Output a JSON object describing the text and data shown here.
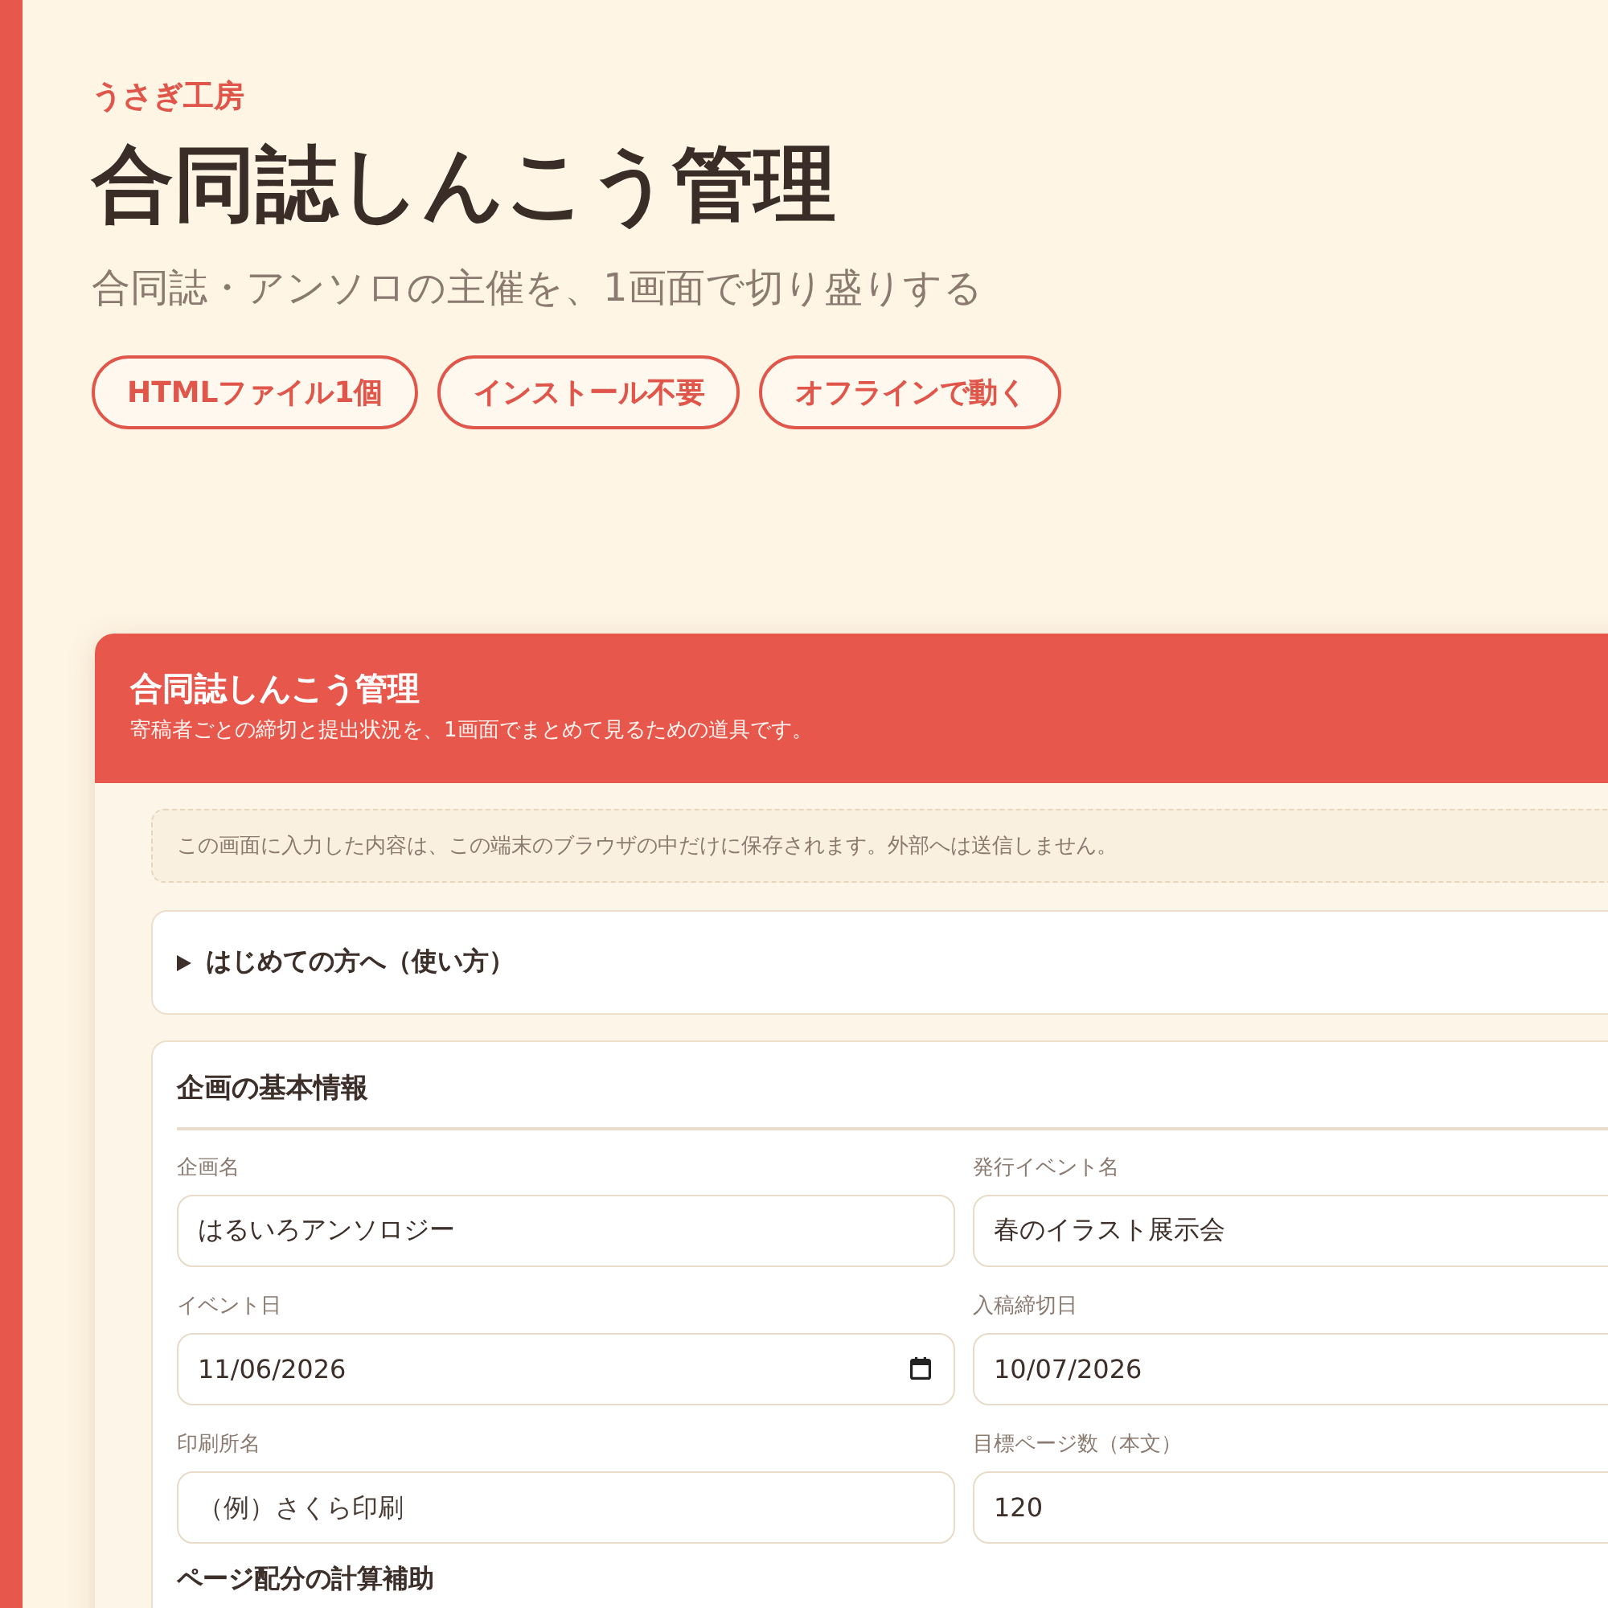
{
  "brand": "うさぎ工房",
  "title": "合同誌しんこう管理",
  "tagline": "合同誌・アンソロの主催を、1画面で切り盛りする",
  "features": [
    "HTMLファイル1個",
    "インストール不要",
    "オフラインで動く"
  ],
  "app": {
    "title": "合同誌しんこう管理",
    "subtitle": "寄稿者ごとの締切と提出状況を、1画面でまとめて見るための道具です。",
    "notice": "この画面に入力した内容は、この端末のブラウザの中だけに保存されます。外部へは送信しません。",
    "guide": {
      "label": "はじめての方へ（使い方）",
      "expanded": false
    },
    "basic_info": {
      "heading": "企画の基本情報",
      "fields": [
        {
          "label": "企画名",
          "value": "はるいろアンソロジー"
        },
        {
          "label": "発行イベント名",
          "value": "春のイラスト展示会"
        },
        {
          "label": "イベント日",
          "value": "11/06/2026",
          "calendar_icon": true
        },
        {
          "label": "入稿締切日",
          "value": "10/07/2026"
        },
        {
          "label": "印刷所名",
          "placeholder": "（例）さくら印刷"
        },
        {
          "label": "目標ページ数（本文）",
          "value": "120"
        }
      ],
      "subheading": "ページ配分の計算補助"
    }
  }
}
